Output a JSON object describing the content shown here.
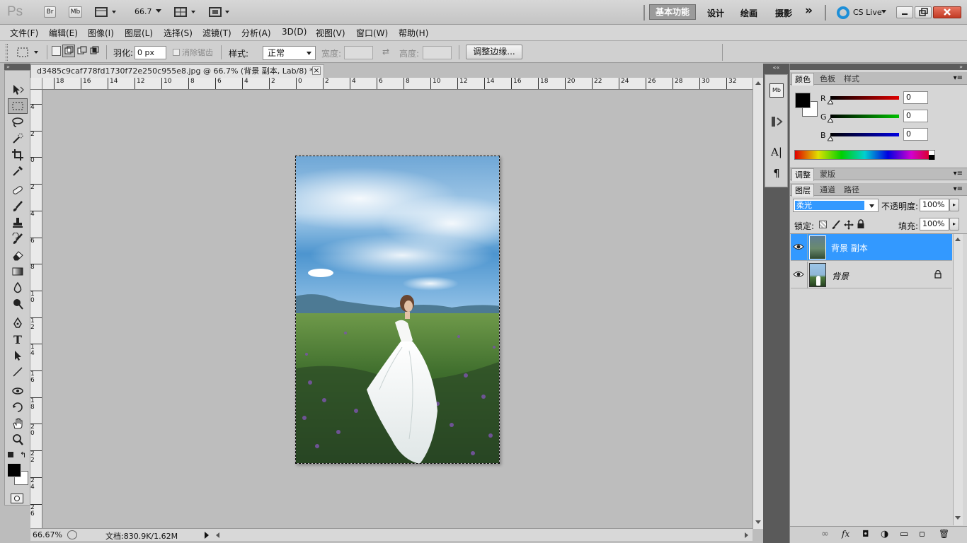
{
  "app": {
    "logo": "Ps",
    "bridge_label": "Br",
    "minibridge_label": "Mb",
    "zoom_display": "66.7",
    "workspaces": [
      "基本功能",
      "设计",
      "绘画",
      "摄影"
    ],
    "more_workspaces": "»",
    "cslive_label": "CS Live"
  },
  "menu": [
    "文件(F)",
    "编辑(E)",
    "图像(I)",
    "图层(L)",
    "选择(S)",
    "滤镜(T)",
    "分析(A)",
    "3D(D)",
    "视图(V)",
    "窗口(W)",
    "帮助(H)"
  ],
  "options": {
    "feather_label": "羽化:",
    "feather_value": "0 px",
    "antialias_label": "消除锯齿",
    "style_label": "样式:",
    "style_value": "正常",
    "width_label": "宽度:",
    "height_label": "高度:",
    "refine_edge_label": "调整边缘..."
  },
  "document": {
    "tab_title": "d3485c9caf778fd1730f72e250c955e8.jpg @ 66.7% (背景 副本, Lab/8) *",
    "close_glyph": "×",
    "h_ruler_ticks": [
      "18",
      "16",
      "14",
      "12",
      "10",
      "8",
      "6",
      "4",
      "2",
      "0",
      "2",
      "4",
      "6",
      "8",
      "10",
      "12",
      "14",
      "16",
      "18",
      "20",
      "22",
      "24",
      "26",
      "28",
      "30",
      "32"
    ],
    "v_ruler_ticks": [
      "4",
      "2",
      "0",
      "2",
      "4",
      "6",
      "8",
      "10",
      "12",
      "14",
      "16",
      "18",
      "20",
      "22",
      "24",
      "26"
    ]
  },
  "status": {
    "zoom": "66.67%",
    "doc_info": "文档:830.9K/1.62M"
  },
  "color_panel": {
    "tabs": [
      "颜色",
      "色板",
      "样式"
    ],
    "channels": [
      {
        "label": "R",
        "value": "0",
        "color": "#d00000"
      },
      {
        "label": "G",
        "value": "0",
        "color": "#00b000"
      },
      {
        "label": "B",
        "value": "0",
        "color": "#0000d0"
      }
    ]
  },
  "adjust_panel": {
    "tabs": [
      "调整",
      "蒙版"
    ]
  },
  "layers_panel": {
    "tabs": [
      "图层",
      "通道",
      "路径"
    ],
    "blend_mode": "柔光",
    "opacity_label": "不透明度:",
    "opacity_value": "100%",
    "lock_label": "锁定:",
    "fill_label": "填充:",
    "fill_value": "100%",
    "layers": [
      {
        "name": "背景 副本",
        "selected": true
      },
      {
        "name": "背景",
        "selected": false,
        "locked": true
      }
    ],
    "footer_glyphs": [
      "∞",
      "fx",
      "◘",
      "◑",
      "▭",
      "▫",
      "🗑"
    ]
  },
  "colors": {
    "selection_blue": "#3399ff",
    "ui_gray": "#d6d6d6"
  }
}
